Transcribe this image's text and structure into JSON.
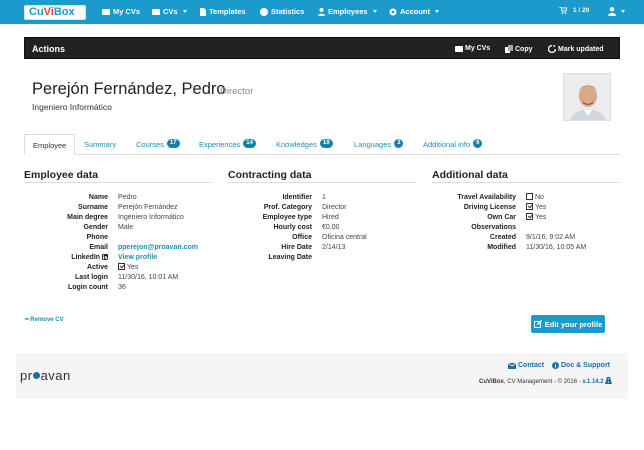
{
  "nav": {
    "logo": {
      "cu": "Cu",
      "vi": "Vi",
      "box": "Box"
    },
    "my_cvs": "My CVs",
    "cvs": "CVs",
    "templates": "Templates",
    "statistics": "Statistics",
    "employees": "Employees",
    "account": "Account",
    "pager": "1 / 20"
  },
  "actions": {
    "title": "Actions",
    "my_cvs": "My CVs",
    "copy": "Copy",
    "mark_updated": "Mark updated"
  },
  "profile": {
    "name": "Perejón Fernández, Pedro",
    "role": "Director",
    "degree": "Ingeniero Informático"
  },
  "tabs": [
    {
      "label": "Employee",
      "count": ""
    },
    {
      "label": "Summary",
      "count": ""
    },
    {
      "label": "Courses",
      "count": "17"
    },
    {
      "label": "Experiences",
      "count": "14"
    },
    {
      "label": "Knowledges",
      "count": "19"
    },
    {
      "label": "Languages",
      "count": "3"
    },
    {
      "label": "Additional info",
      "count": "6"
    }
  ],
  "employee": {
    "title": "Employee data",
    "rows": [
      {
        "k": "Name",
        "v": "Pedro"
      },
      {
        "k": "Surname",
        "v": "Perejón Fernández"
      },
      {
        "k": "Main degree",
        "v": "Ingeniero Informático"
      },
      {
        "k": "Gender",
        "v": "Male"
      },
      {
        "k": "Phone",
        "v": ""
      },
      {
        "k": "Email",
        "v": "pperejon@proavan.com"
      },
      {
        "k": "LinkedIn",
        "v": "View profile"
      },
      {
        "k": "Active",
        "v": "Yes"
      },
      {
        "k": "Last login",
        "v": "11/30/16, 10:01 AM"
      },
      {
        "k": "Login count",
        "v": "36"
      }
    ]
  },
  "contracting": {
    "title": "Contracting data",
    "rows": [
      {
        "k": "Identifier",
        "v": "1"
      },
      {
        "k": "Prof. Category",
        "v": "Director"
      },
      {
        "k": "Employee type",
        "v": "Hired"
      },
      {
        "k": "Hourly cost",
        "v": "€0.00"
      },
      {
        "k": "Office",
        "v": "Oficina central"
      },
      {
        "k": "Hire Date",
        "v": "2/14/13"
      },
      {
        "k": "Leaving Date",
        "v": ""
      }
    ]
  },
  "additional": {
    "title": "Additional data",
    "rows": [
      {
        "k": "Travel Availability",
        "v": "No"
      },
      {
        "k": "Driving License",
        "v": "Yes"
      },
      {
        "k": "Own Car",
        "v": "Yes"
      },
      {
        "k": "Observations",
        "v": ""
      },
      {
        "k": "Created",
        "v": "9/1/16, 9:02 AM"
      },
      {
        "k": "Modified",
        "v": "11/30/16, 10:05 AM"
      }
    ]
  },
  "remove_cv": "Remove CV",
  "edit_profile": "Edit your profile",
  "footer": {
    "brand_a": "pr",
    "brand_b": "avan",
    "contact": "Contact",
    "doc_support": "Doc & Support",
    "product": "CuViBox",
    "copyright": ", CV Management - © 2016 - ",
    "version": "v.1.14.2"
  },
  "colors": {
    "accent": "#1a9bcc",
    "actions_bar": "#222222",
    "link": "#1a8ec0"
  }
}
